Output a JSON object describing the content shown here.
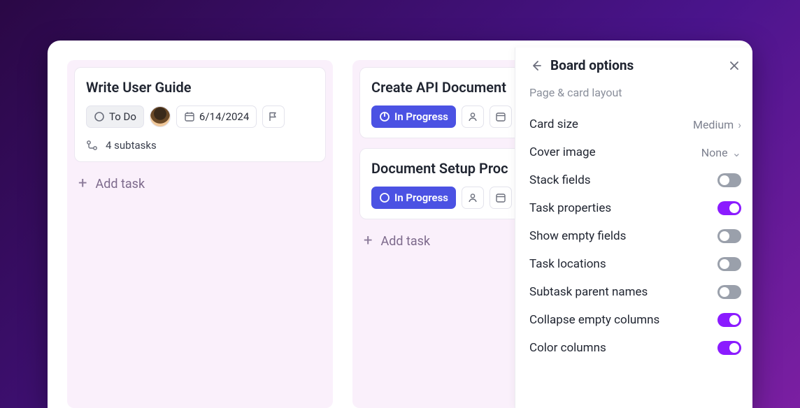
{
  "columns": [
    {
      "add_label": "Add task",
      "cards": [
        {
          "title": "Write User Guide",
          "status": {
            "kind": "todo",
            "label": "To Do"
          },
          "has_avatar": true,
          "date": "6/14/2024",
          "has_flag": true,
          "subtasks_label": "4 subtasks"
        }
      ]
    },
    {
      "add_label": "Add task",
      "cards": [
        {
          "title": "Create API Document",
          "status": {
            "kind": "inprog",
            "label": "In Progress"
          },
          "has_assignee_placeholder": true,
          "has_date_placeholder": true
        },
        {
          "title": "Document Setup Proc",
          "status": {
            "kind": "inprog",
            "label": "In Progress"
          },
          "has_assignee_placeholder": true,
          "has_date_placeholder": true
        }
      ]
    }
  ],
  "panel": {
    "title": "Board options",
    "section_label": "Page & card layout",
    "card_size": {
      "label": "Card size",
      "value": "Medium"
    },
    "cover_image": {
      "label": "Cover image",
      "value": "None"
    },
    "toggles": [
      {
        "label": "Stack fields",
        "on": false
      },
      {
        "label": "Task properties",
        "on": true
      },
      {
        "label": "Show empty fields",
        "on": false
      },
      {
        "label": "Task locations",
        "on": false
      },
      {
        "label": "Subtask parent names",
        "on": false
      },
      {
        "label": "Collapse empty columns",
        "on": true
      },
      {
        "label": "Color columns",
        "on": true
      }
    ]
  }
}
